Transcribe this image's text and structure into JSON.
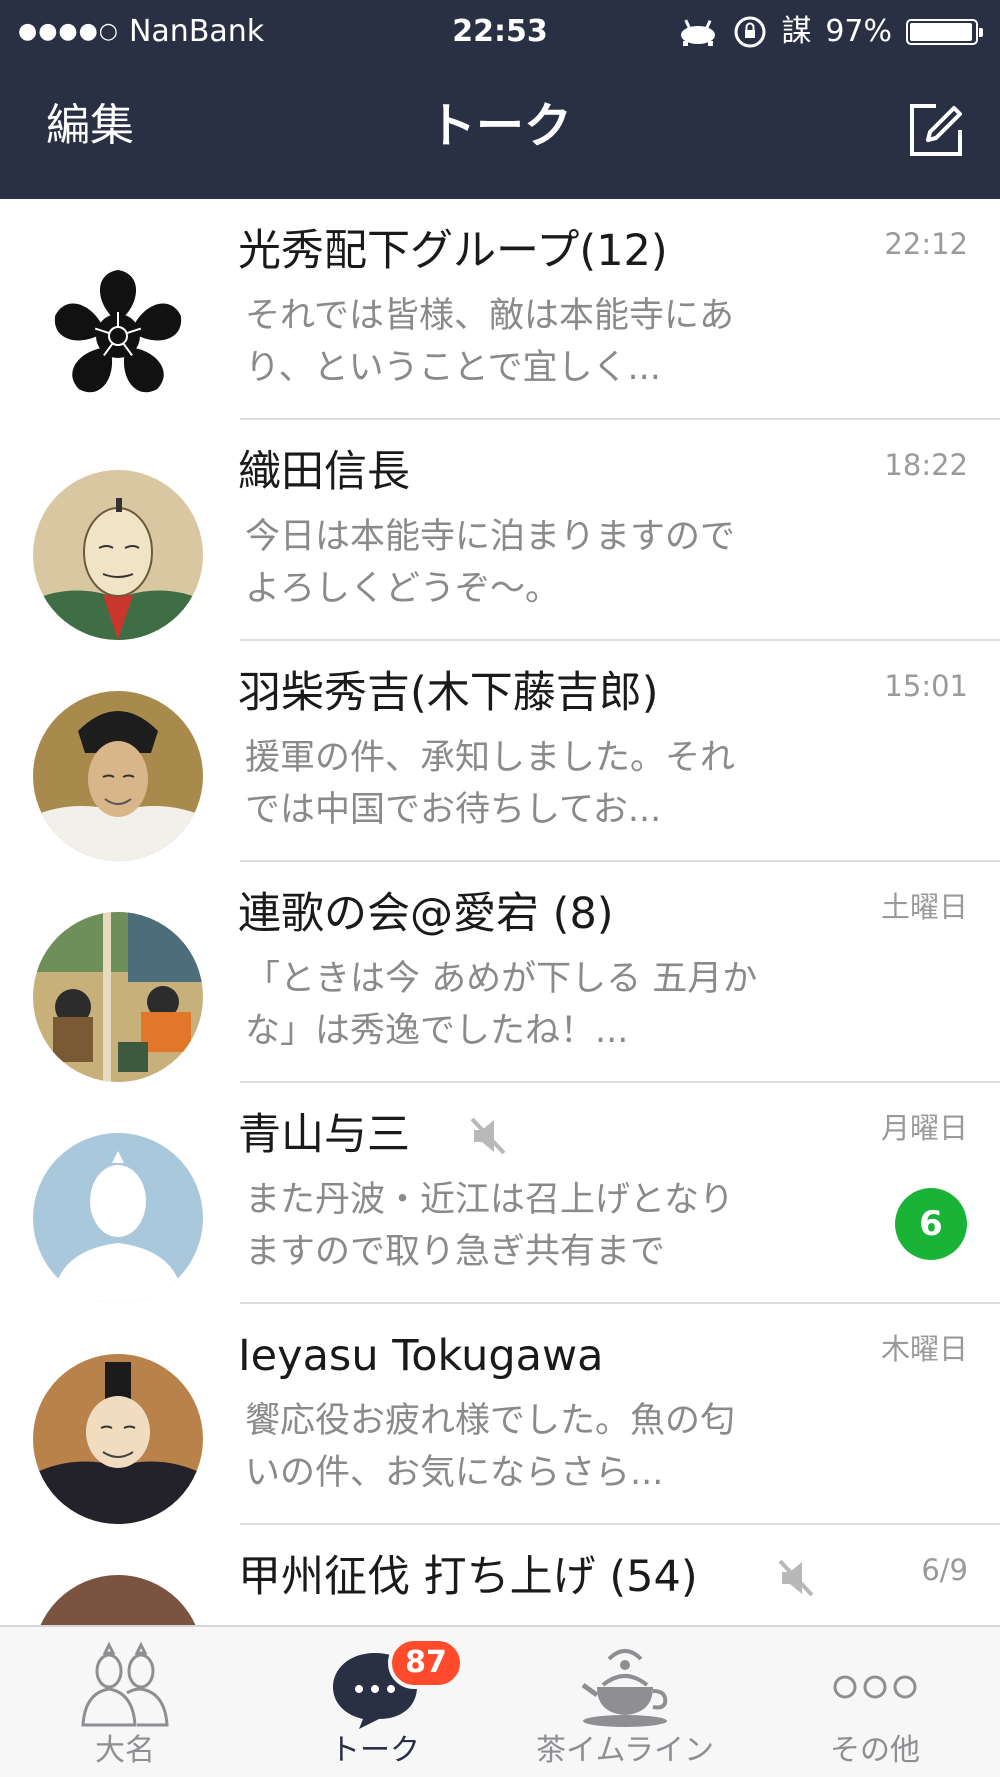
{
  "status_bar": {
    "signal": "●●●●○",
    "carrier": "NanBank",
    "time": "22:53",
    "glyph": "謀",
    "battery": "97%",
    "battery_level": 0.97
  },
  "nav": {
    "edit_label": "編集",
    "title": "トーク",
    "compose_icon": "compose-icon"
  },
  "colors": {
    "nav_bg": "#2a3044",
    "badge_green": "#19b437",
    "badge_red": "#ff4b2b",
    "muted_text": "#8a8a8a"
  },
  "chats": [
    {
      "name": "光秀配下グループ(12)",
      "message": "それでは皆様、敵は本能寺にあり、ということで宜しく...",
      "time": "22:12",
      "avatar": "kikyo-crest",
      "muted": false,
      "unread": ""
    },
    {
      "name": "織田信長",
      "message": "今日は本能寺に泊まりますのでよろしくどうぞ〜。",
      "time": "18:22",
      "avatar": "portrait-nobunaga",
      "muted": false,
      "unread": ""
    },
    {
      "name": "羽柴秀吉(木下藤吉郎)",
      "message": "援軍の件、承知しました。それでは中国でお待ちしてお...",
      "time": "15:01",
      "avatar": "portrait-hideyoshi",
      "muted": false,
      "unread": ""
    },
    {
      "name": "連歌の会@愛宕 (8)",
      "message": "「ときは今 あめが下しる 五月かな」は秀逸でしたね！...",
      "time": "土曜日",
      "avatar": "painting-renga",
      "muted": false,
      "unread": ""
    },
    {
      "name": "青山与三",
      "message": "また丹波・近江は召上げとなりますので取り急ぎ共有まで",
      "time": "月曜日",
      "avatar": "default-avatar",
      "muted": true,
      "unread": "6"
    },
    {
      "name": "Ieyasu Tokugawa",
      "message": "饗応役お疲れ様でした。魚の匂いの件、お気にならさら...",
      "time": "木曜日",
      "avatar": "portrait-ieyasu",
      "muted": false,
      "unread": ""
    },
    {
      "name": "甲州征伐 打ち上げ (54)",
      "message": "",
      "time": "6/9",
      "avatar": "brown-character",
      "muted": true,
      "unread": ""
    }
  ],
  "tabs": [
    {
      "label": "大名",
      "icon": "friends-icon",
      "active": false
    },
    {
      "label": "トーク",
      "icon": "chat-bubble-icon",
      "active": true,
      "badge": "87"
    },
    {
      "label": "茶イムライン",
      "icon": "teapot-icon",
      "active": false
    },
    {
      "label": "その他",
      "icon": "more-icon",
      "active": false
    }
  ]
}
